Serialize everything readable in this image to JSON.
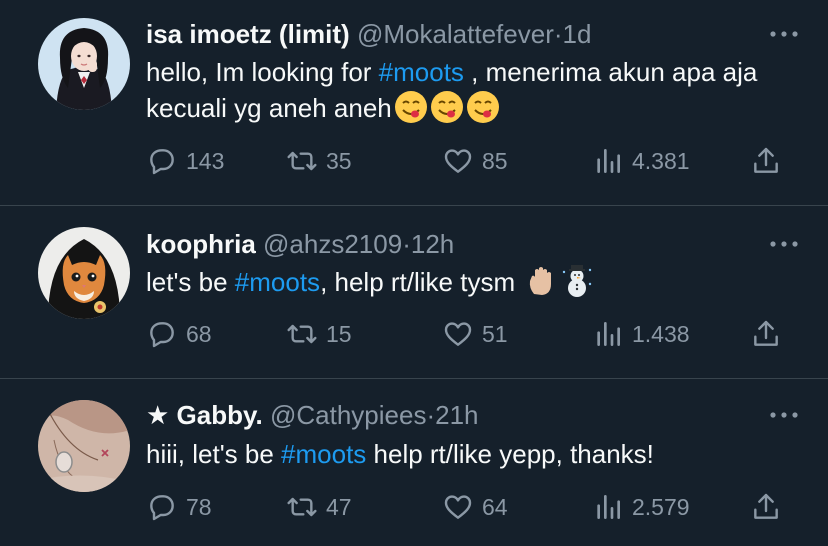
{
  "tweets": [
    {
      "name": "isa imoetz (limit)",
      "handle": "@Mokalattefever",
      "sep": "·",
      "time": "1d",
      "text_before": "hello, Im looking for ",
      "hashtag": "#moots",
      "text_after": " , menerima akun apa aja kecuali yg aneh aneh",
      "emojis": [
        "😋",
        "😋",
        "😋"
      ],
      "replies": "143",
      "retweets": "35",
      "likes": "85",
      "views": "4.381"
    },
    {
      "name": "koophria",
      "handle": "@ahzs2109",
      "sep": "·",
      "time": "12h",
      "text_before": "let's be ",
      "hashtag": "#moots",
      "text_after": ", help rt/like tysm ",
      "emojis": [
        "✋🏼",
        "☃️"
      ],
      "replies": "68",
      "retweets": "15",
      "likes": "51",
      "views": "1.438"
    },
    {
      "name": "★ Gabby.",
      "handle": "@Cathypiees",
      "sep": "·",
      "time": "21h",
      "text_before": "hiii, let's be ",
      "hashtag": "#moots",
      "text_after": " help rt/like yepp, thanks!",
      "emojis": [],
      "replies": "78",
      "retweets": "47",
      "likes": "64",
      "views": "2.579"
    }
  ],
  "colors": {
    "background": "#15202b",
    "text": "#f7f9f9",
    "secondary": "#8b98a5",
    "accent": "#1d9bf0",
    "divider": "#38444d"
  },
  "icons": [
    "reply-icon",
    "retweet-icon",
    "like-icon",
    "views-icon",
    "share-icon",
    "more-icon"
  ]
}
